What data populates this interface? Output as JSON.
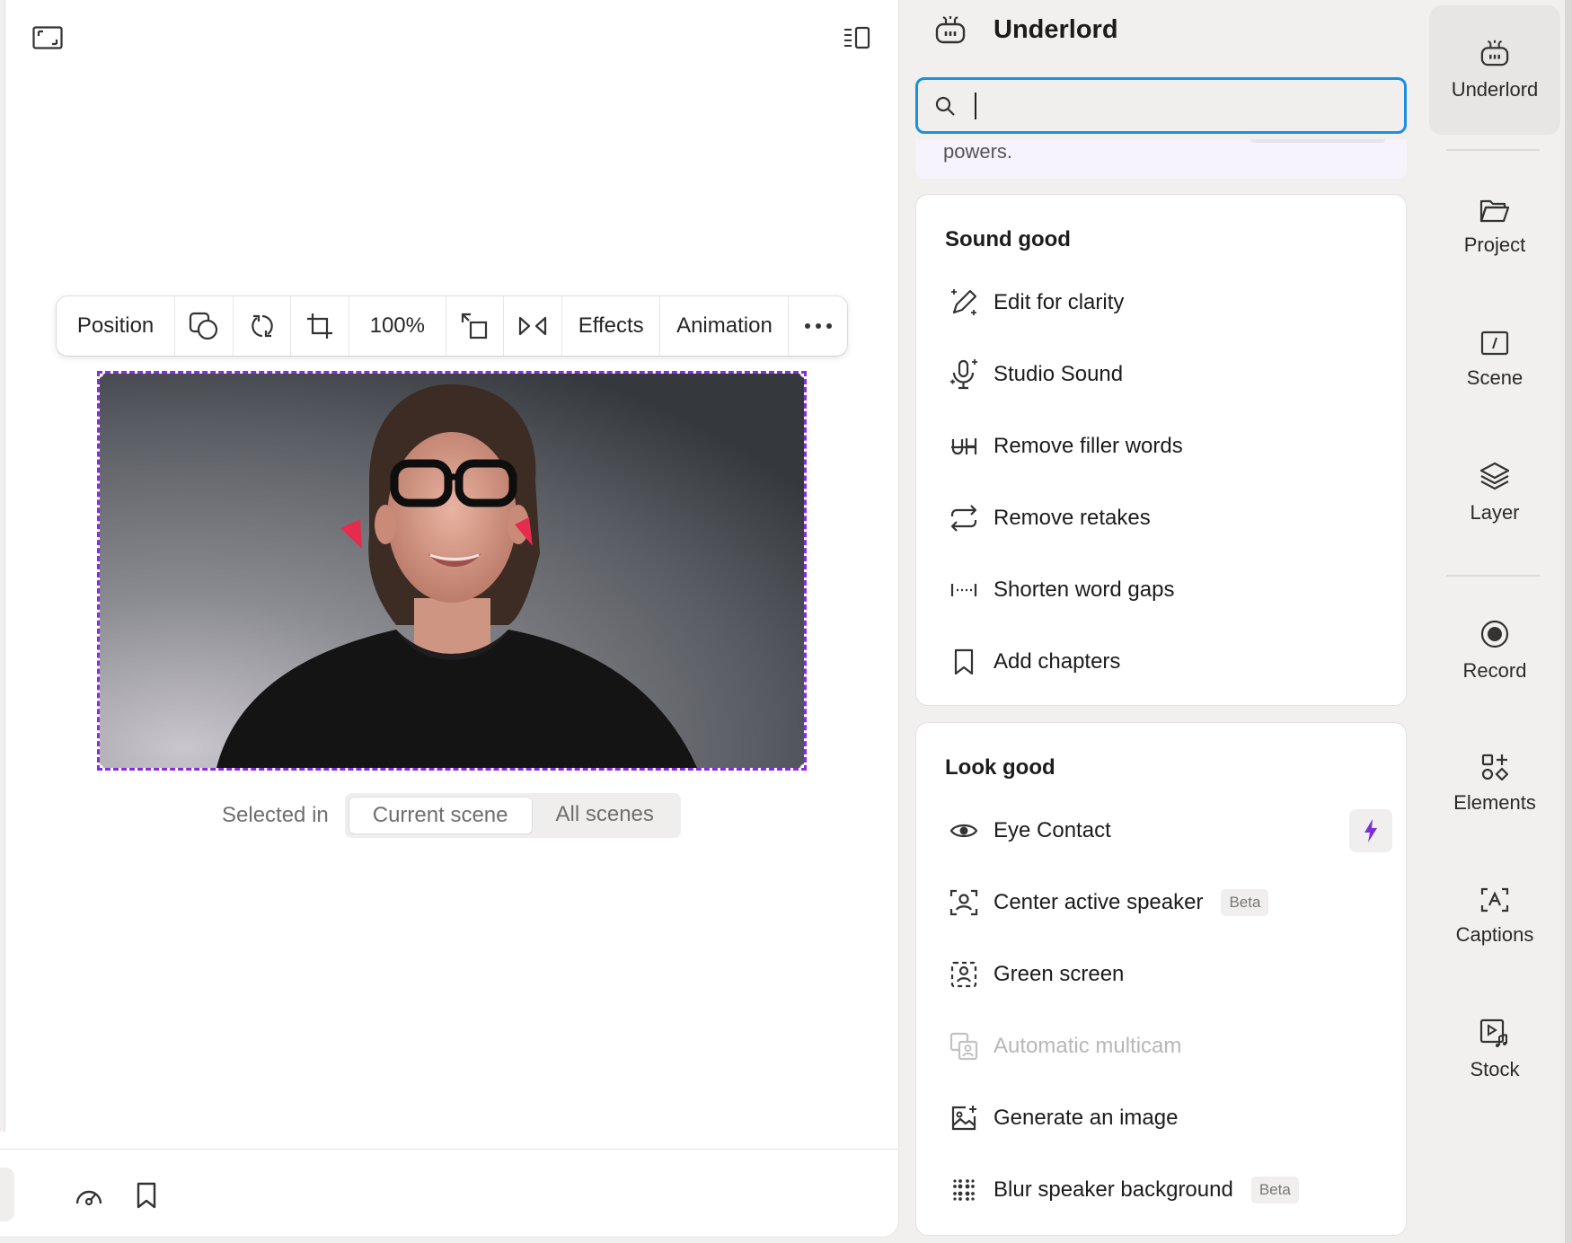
{
  "canvas": {
    "toolbar": {
      "position_label": "Position",
      "zoom_label": "100%",
      "effects_label": "Effects",
      "animation_label": "Animation"
    },
    "scene_toggle": {
      "label": "Selected in",
      "current_scene": "Current scene",
      "all_scenes": "All scenes"
    }
  },
  "underlord": {
    "title": "Underlord",
    "search": {
      "value": "",
      "placeholder": ""
    },
    "promo_text": "powers.",
    "sound_good": {
      "title": "Sound good",
      "items": [
        {
          "label": "Edit for clarity",
          "icon": "pen-sparkle-icon"
        },
        {
          "label": "Studio Sound",
          "icon": "microphone-sparkle-icon"
        },
        {
          "label": "Remove filler words",
          "icon": "strikethrough-uh-icon"
        },
        {
          "label": "Remove retakes",
          "icon": "repeat-icon"
        },
        {
          "label": "Shorten word gaps",
          "icon": "word-gap-icon"
        },
        {
          "label": "Add chapters",
          "icon": "bookmark-icon"
        }
      ]
    },
    "look_good": {
      "title": "Look good",
      "items": [
        {
          "label": "Eye Contact",
          "icon": "eye-icon"
        },
        {
          "label": "Center active speaker",
          "icon": "center-speaker-icon",
          "badge": "Beta"
        },
        {
          "label": "Green screen",
          "icon": "green-screen-icon"
        },
        {
          "label": "Automatic multicam",
          "icon": "multicam-icon"
        },
        {
          "label": "Generate an image",
          "icon": "image-sparkle-icon"
        },
        {
          "label": "Blur speaker background",
          "icon": "blur-icon",
          "badge": "Beta"
        }
      ]
    }
  },
  "side_nav": {
    "items": [
      {
        "label": "Underlord",
        "icon": "robot-icon"
      },
      {
        "label": "Project",
        "icon": "folder-icon"
      },
      {
        "label": "Scene",
        "icon": "scene-icon"
      },
      {
        "label": "Layer",
        "icon": "layers-icon"
      },
      {
        "label": "Record",
        "icon": "record-icon"
      },
      {
        "label": "Elements",
        "icon": "elements-icon"
      },
      {
        "label": "Captions",
        "icon": "captions-icon"
      },
      {
        "label": "Stock",
        "icon": "stock-media-icon"
      }
    ]
  },
  "colors": {
    "selection": "#8a2be2",
    "search_focus": "#1d8fe0",
    "accent_bolt": "#7a2fd8"
  }
}
